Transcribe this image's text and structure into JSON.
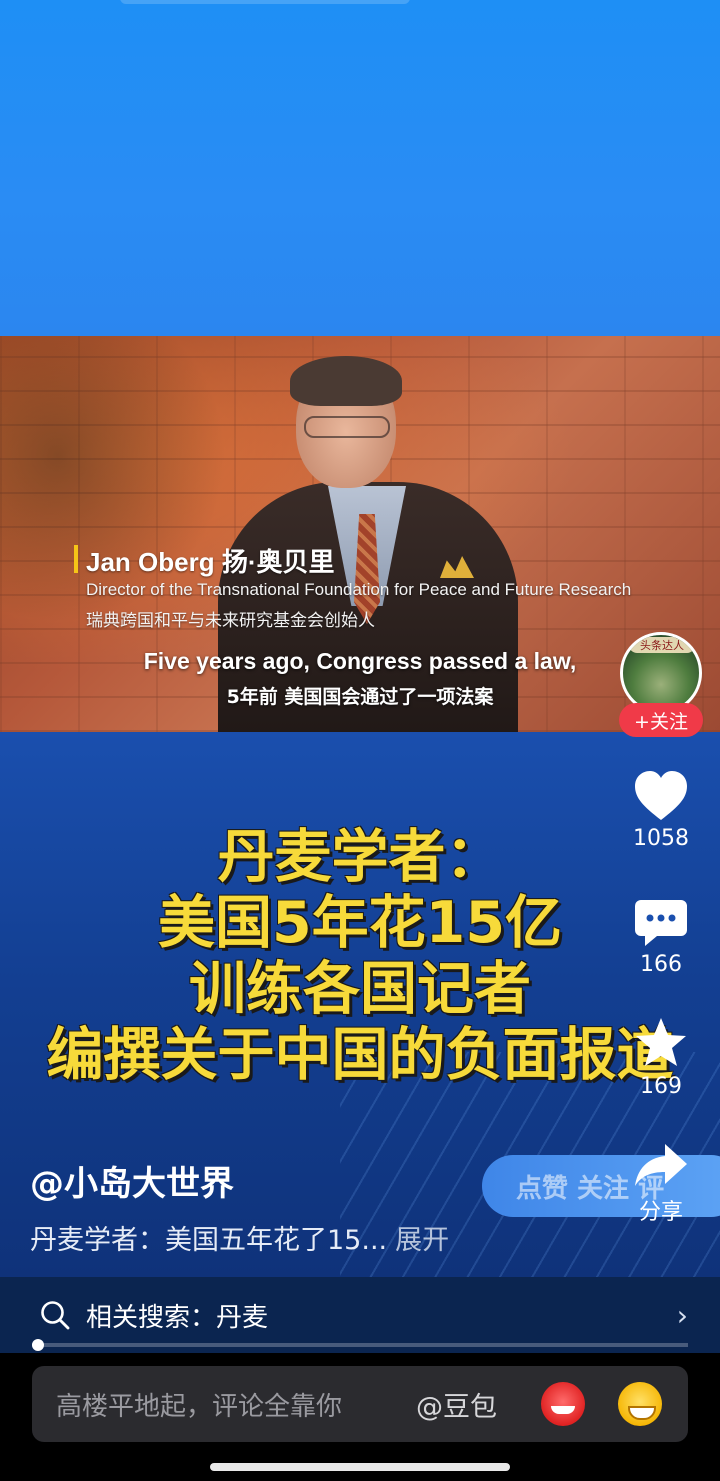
{
  "video": {
    "speaker_name": "Jan Oberg 扬·奥贝里",
    "speaker_title_en": "Director of the Transnational Foundation for Peace and Future Research",
    "speaker_title_cn": "瑞典跨国和平与未来研究基金会创始人",
    "subtitle_en": "Five years ago, Congress passed a law,",
    "subtitle_cn": "5年前 美国国会通过了一项法案"
  },
  "headline": {
    "lines": [
      "丹麦学者：",
      "美国5年花15亿",
      "训练各国记者",
      "编撰关于中国的负面报道"
    ]
  },
  "creator": {
    "avatar_badge": "头条达人",
    "follow_label": "+关注",
    "handle": "@小岛大世界"
  },
  "actions": {
    "like_count": "1058",
    "comment_count": "166",
    "favorite_count": "169",
    "share_label": "分享",
    "pill_text": "点赞  关注  评"
  },
  "description": {
    "text": "丹麦学者：美国五年花了15...",
    "expand_label": "展开"
  },
  "search": {
    "label": "相关搜索：丹麦"
  },
  "comment": {
    "placeholder": "高楼平地起，评论全靠你",
    "mention": "@豆包"
  },
  "icons": [
    "heart-icon",
    "comment-icon",
    "star-icon",
    "share-icon",
    "search-icon",
    "chevron-right-icon"
  ]
}
